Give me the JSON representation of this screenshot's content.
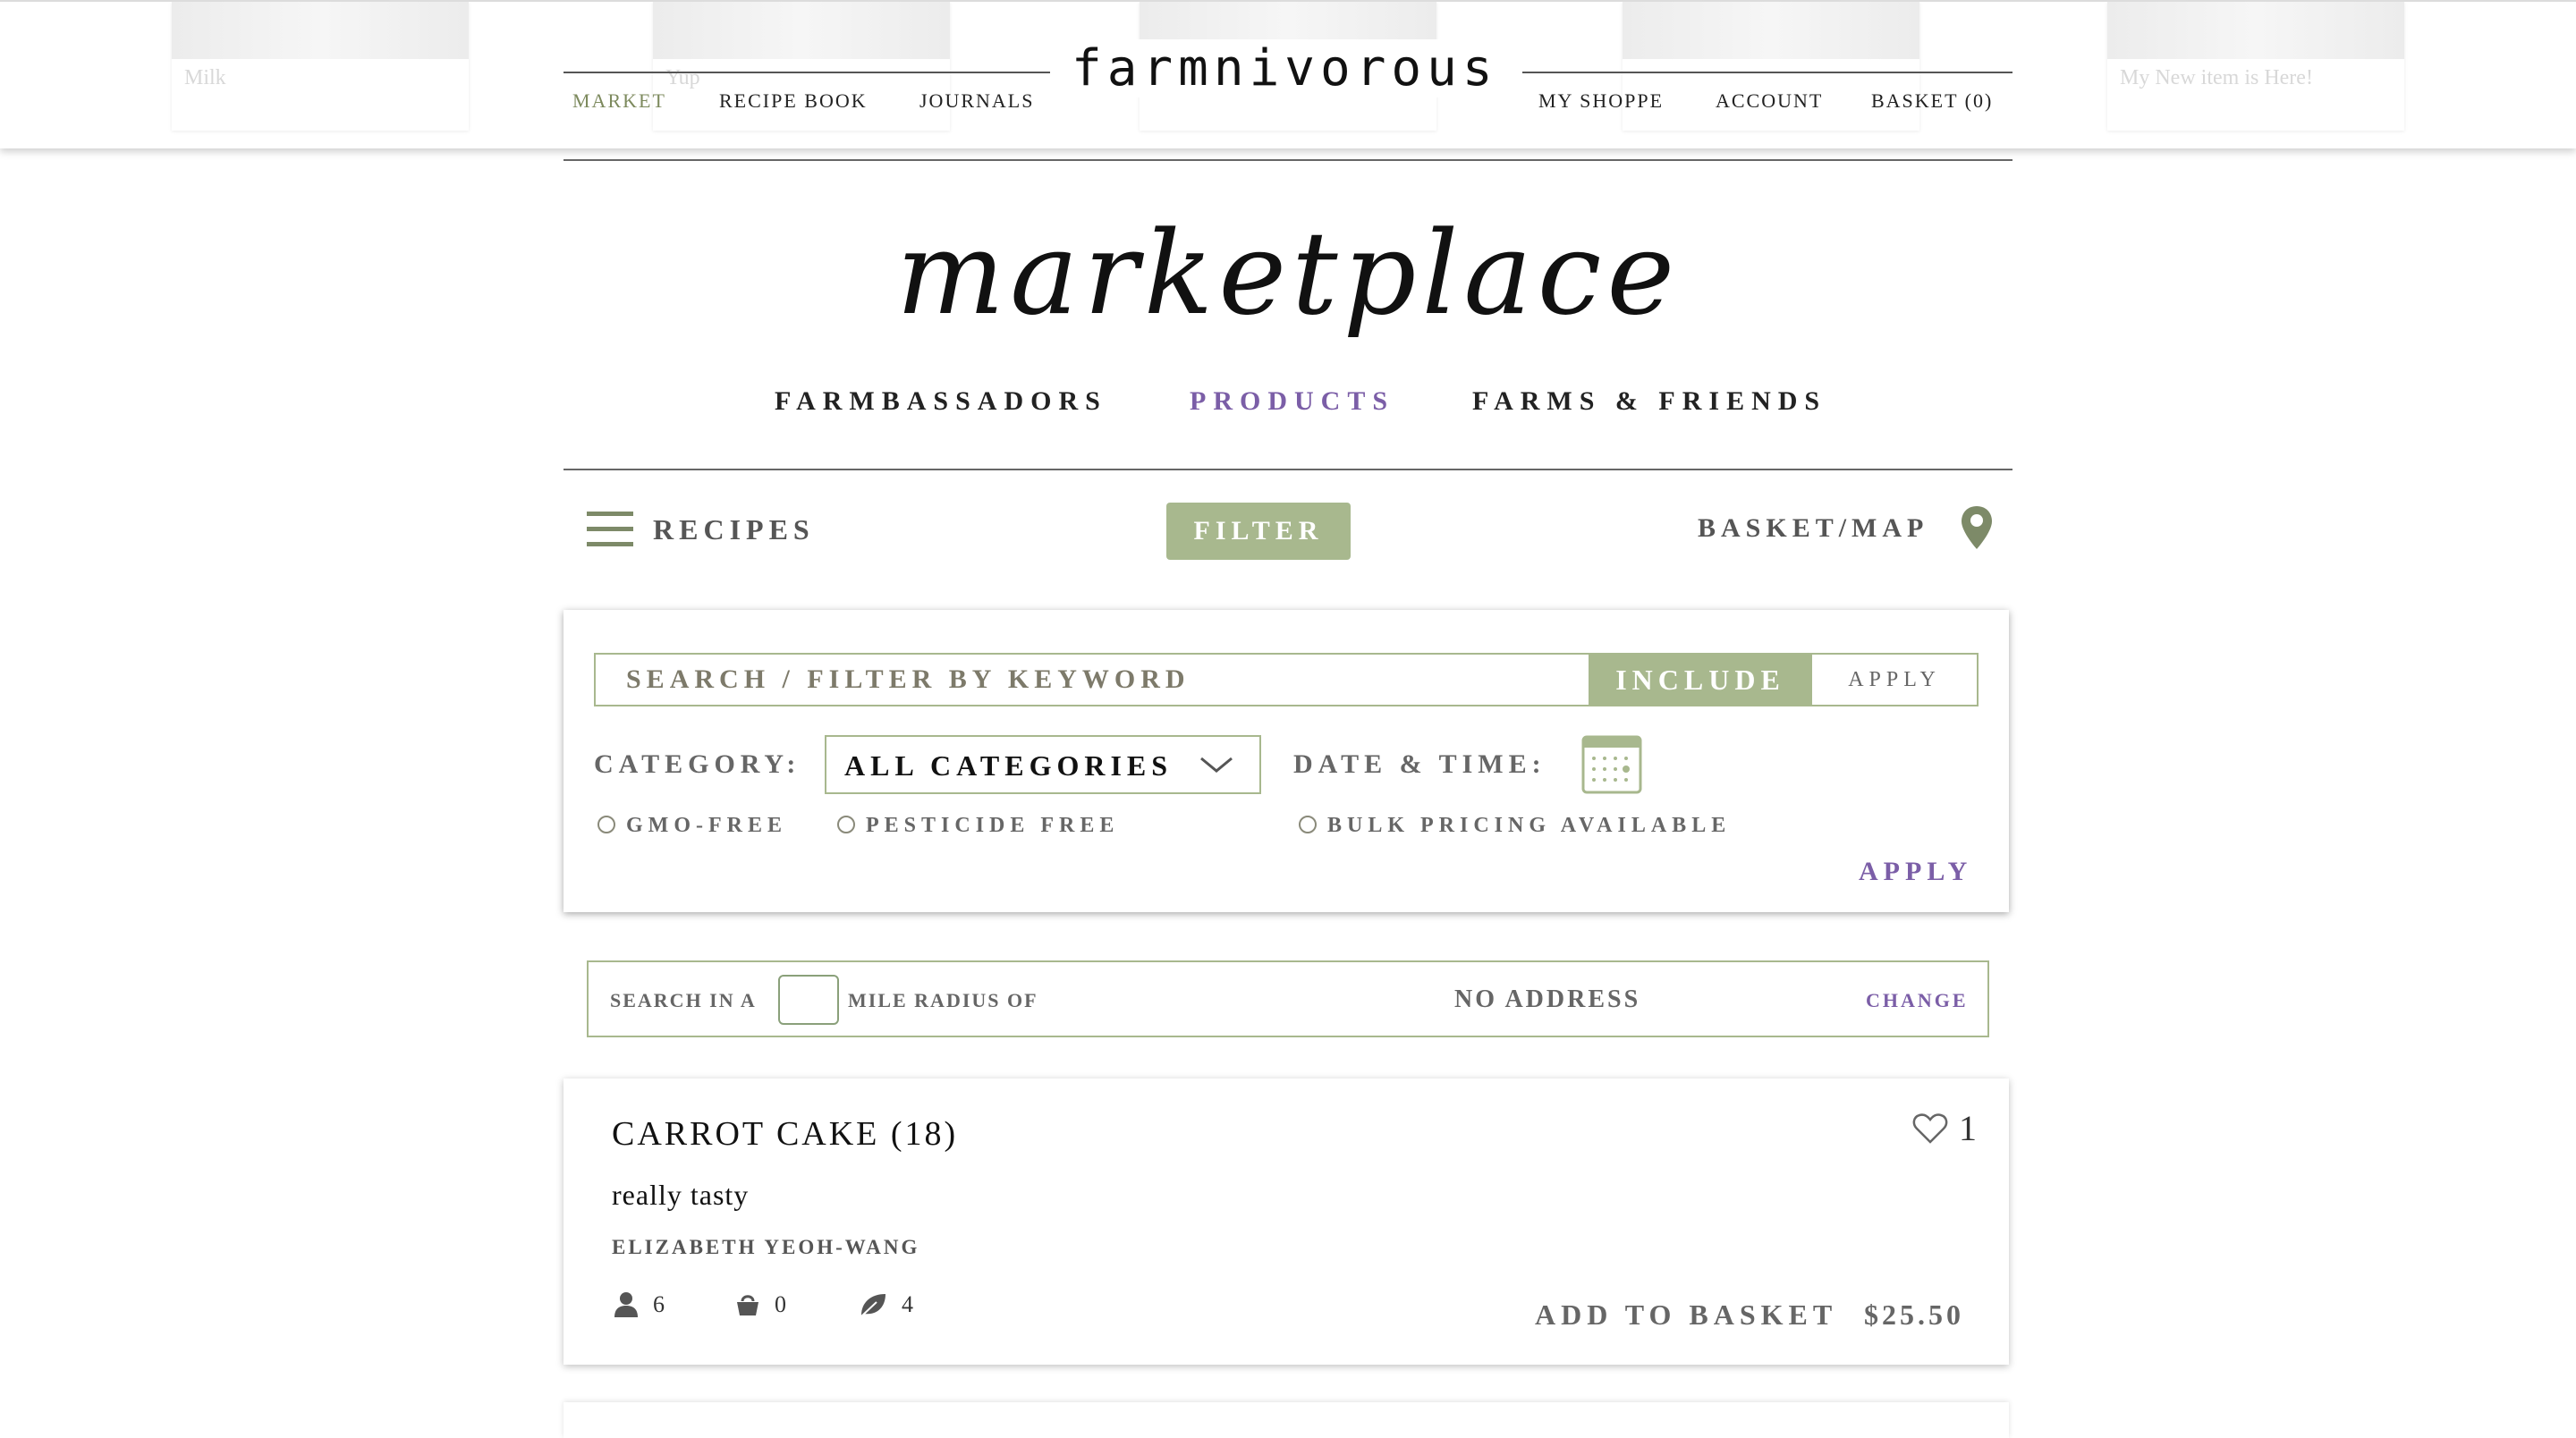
{
  "header": {
    "brand": "farmnivorous",
    "nav_left": [
      "MARKET",
      "RECIPE BOOK",
      "JOURNALS"
    ],
    "nav_right": [
      "MY SHOPPE",
      "ACCOUNT",
      "BASKET (0)"
    ],
    "background_cards": [
      "Milk",
      "Yup",
      "",
      "",
      "My New item is Here!"
    ]
  },
  "page": {
    "title": "marketplace",
    "subnav": [
      "FARMBASSADORS",
      "PRODUCTS",
      "FARMS & FRIENDS"
    ],
    "active_subnav": "PRODUCTS"
  },
  "toolbar": {
    "recipes_label": "RECIPES",
    "filter_label": "FILTER",
    "basket_map_label": "BASKET/MAP"
  },
  "filter": {
    "keyword_placeholder": "SEARCH / FILTER BY KEYWORD",
    "include_label": "INCLUDE",
    "apply_small_label": "APPLY",
    "category_label": "CATEGORY:",
    "category_value": "ALL CATEGORIES",
    "datetime_label": "DATE & TIME:",
    "options": [
      "GMO-FREE",
      "PESTICIDE FREE",
      "BULK PRICING AVAILABLE"
    ],
    "apply_label": "APPLY"
  },
  "radius": {
    "prefix": "SEARCH IN A",
    "suffix": "MILE RADIUS OF",
    "address": "NO ADDRESS",
    "change_label": "CHANGE"
  },
  "products": [
    {
      "title": "CARROT CAKE (18)",
      "likes": "1",
      "description": "really tasty",
      "seller": "ELIZABETH YEOH-WANG",
      "stats": {
        "people": "6",
        "baskets": "0",
        "leaves": "4"
      },
      "add_label": "ADD TO BASKET",
      "price": "$25.50"
    }
  ],
  "colors": {
    "accent_green": "#a8b88e",
    "accent_purple": "#7b5ea7",
    "text_gray": "#666666"
  }
}
